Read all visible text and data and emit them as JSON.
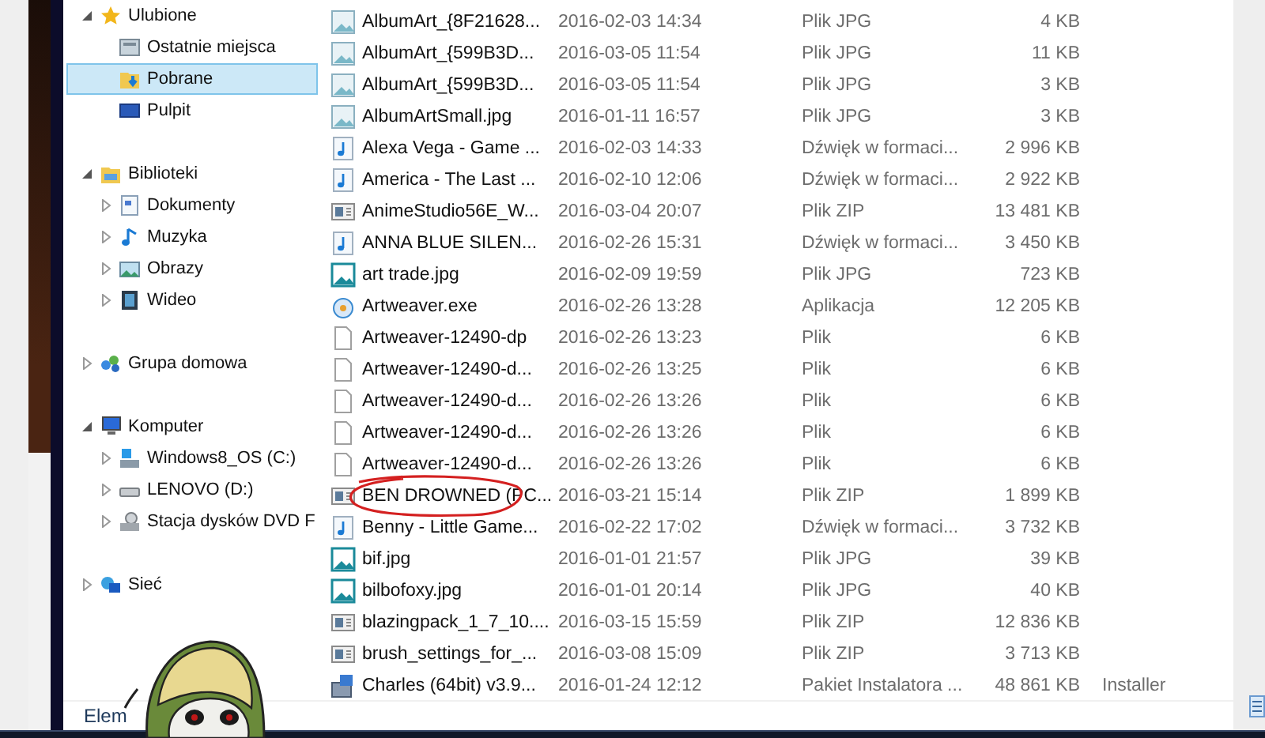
{
  "navigation": [
    {
      "label": "Ulubione",
      "kind": "star",
      "expanded": true,
      "selected": false,
      "children": [
        {
          "label": "Ostatnie miejsca",
          "kind": "recent",
          "selected": false
        },
        {
          "label": "Pobrane",
          "kind": "downloads",
          "selected": true
        },
        {
          "label": "Pulpit",
          "kind": "desktop",
          "selected": false
        }
      ]
    },
    {
      "label": "Biblioteki",
      "kind": "library",
      "expanded": true,
      "selected": false,
      "children": [
        {
          "label": "Dokumenty",
          "kind": "documents",
          "expanded": false,
          "selected": false
        },
        {
          "label": "Muzyka",
          "kind": "music",
          "expanded": false,
          "selected": false
        },
        {
          "label": "Obrazy",
          "kind": "pictures",
          "expanded": false,
          "selected": false
        },
        {
          "label": "Wideo",
          "kind": "video",
          "expanded": false,
          "selected": false
        }
      ]
    },
    {
      "label": "Grupa domowa",
      "kind": "homegroup",
      "expanded": false,
      "selected": false
    },
    {
      "label": "Komputer",
      "kind": "computer",
      "expanded": true,
      "selected": false,
      "children": [
        {
          "label": "Windows8_OS (C:)",
          "kind": "system-drive",
          "expanded": false,
          "selected": false
        },
        {
          "label": "LENOVO (D:)",
          "kind": "drive",
          "expanded": false,
          "selected": false
        },
        {
          "label": "Stacja dysków DVD F",
          "kind": "dvd",
          "expanded": false,
          "selected": false
        }
      ]
    },
    {
      "label": "Sieć",
      "kind": "network",
      "expanded": false,
      "selected": false
    }
  ],
  "files": [
    {
      "kind": "image",
      "name": "AlbumArt_{8F21628...",
      "date": "2016-02-03 14:34",
      "type": "Plik JPG",
      "size": "4 KB"
    },
    {
      "kind": "image",
      "name": "AlbumArt_{599B3D...",
      "date": "2016-03-05 11:54",
      "type": "Plik JPG",
      "size": "11 KB"
    },
    {
      "kind": "image",
      "name": "AlbumArt_{599B3D...",
      "date": "2016-03-05 11:54",
      "type": "Plik JPG",
      "size": "3 KB"
    },
    {
      "kind": "image",
      "name": "AlbumArtSmall.jpg",
      "date": "2016-01-11 16:57",
      "type": "Plik JPG",
      "size": "3 KB"
    },
    {
      "kind": "audio",
      "name": "Alexa Vega - Game ...",
      "date": "2016-02-03 14:33",
      "type": "Dźwięk w formaci...",
      "size": "2 996 KB"
    },
    {
      "kind": "audio",
      "name": "America - The Last ...",
      "date": "2016-02-10 12:06",
      "type": "Dźwięk w formaci...",
      "size": "2 922 KB"
    },
    {
      "kind": "zip",
      "name": "AnimeStudio56E_W...",
      "date": "2016-03-04 20:07",
      "type": "Plik ZIP",
      "size": "13 481 KB"
    },
    {
      "kind": "audio",
      "name": "ANNA BLUE   SILEN...",
      "date": "2016-02-26 15:31",
      "type": "Dźwięk w formaci...",
      "size": "3 450 KB"
    },
    {
      "kind": "photo",
      "name": "art trade.jpg",
      "date": "2016-02-09 19:59",
      "type": "Plik JPG",
      "size": "723 KB"
    },
    {
      "kind": "exe",
      "name": "Artweaver.exe",
      "date": "2016-02-26 13:28",
      "type": "Aplikacja",
      "size": "12 205 KB"
    },
    {
      "kind": "file",
      "name": "Artweaver-12490-dp",
      "date": "2016-02-26 13:23",
      "type": "Plik",
      "size": "6 KB"
    },
    {
      "kind": "file",
      "name": "Artweaver-12490-d...",
      "date": "2016-02-26 13:25",
      "type": "Plik",
      "size": "6 KB"
    },
    {
      "kind": "file",
      "name": "Artweaver-12490-d...",
      "date": "2016-02-26 13:26",
      "type": "Plik",
      "size": "6 KB"
    },
    {
      "kind": "file",
      "name": "Artweaver-12490-d...",
      "date": "2016-02-26 13:26",
      "type": "Plik",
      "size": "6 KB"
    },
    {
      "kind": "file",
      "name": "Artweaver-12490-d...",
      "date": "2016-02-26 13:26",
      "type": "Plik",
      "size": "6 KB"
    },
    {
      "kind": "zip",
      "name": "BEN DROWNED (PC...",
      "date": "2016-03-21 15:14",
      "type": "Plik ZIP",
      "size": "1 899 KB",
      "circled": true
    },
    {
      "kind": "audio",
      "name": "Benny - Little Game...",
      "date": "2016-02-22 17:02",
      "type": "Dźwięk w formaci...",
      "size": "3 732 KB"
    },
    {
      "kind": "photo",
      "name": "bif.jpg",
      "date": "2016-01-01 21:57",
      "type": "Plik JPG",
      "size": "39 KB"
    },
    {
      "kind": "photo",
      "name": "bilbofoxy.jpg",
      "date": "2016-01-01 20:14",
      "type": "Plik JPG",
      "size": "40 KB"
    },
    {
      "kind": "zip",
      "name": "blazingpack_1_7_10....",
      "date": "2016-03-15 15:59",
      "type": "Plik ZIP",
      "size": "12 836 KB"
    },
    {
      "kind": "zip",
      "name": "brush_settings_for_...",
      "date": "2016-03-08 15:09",
      "type": "Plik ZIP",
      "size": "3 713 KB"
    },
    {
      "kind": "installer",
      "name": "Charles (64bit) v3.9...",
      "date": "2016-01-24 12:12",
      "type": "Pakiet Instalatora ...",
      "size": "48 861 KB",
      "column_5": "Installer"
    }
  ],
  "status_bar": {
    "text": "Elem"
  }
}
